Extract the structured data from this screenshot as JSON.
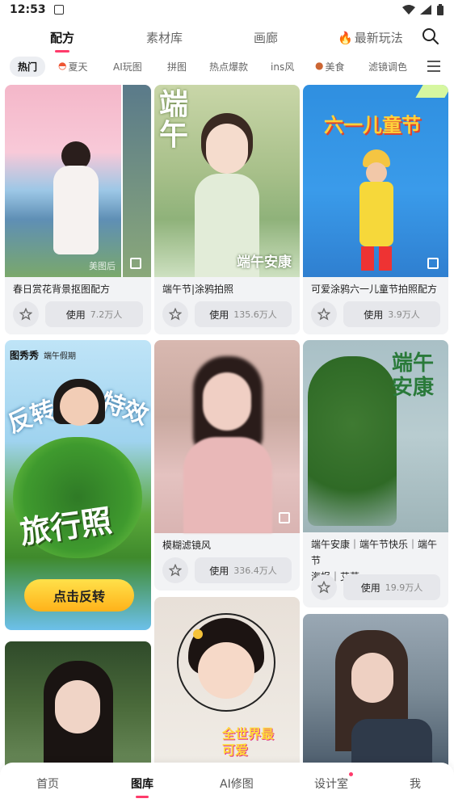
{
  "status_bar": {
    "time": "12:53"
  },
  "top_tabs": [
    "配方",
    "素材库",
    "画廊",
    "最新玩法"
  ],
  "chips": [
    "热门",
    "夏天",
    "AI玩图",
    "拼图",
    "热点爆款",
    "ins风",
    "美食",
    "滤镜调色"
  ],
  "cards": {
    "c1": {
      "title": "春日赏花背景抠图配方",
      "use_label": "使用",
      "count": "7.2万人",
      "watermark": "美图后"
    },
    "c2": {
      "title": "端午节|涂鸦拍照",
      "use_label": "使用",
      "count": "135.6万人",
      "overlay_big": "端午",
      "overlay_small": "端午安康"
    },
    "c3": {
      "title": "可爱涂鸦六一儿童节拍照配方",
      "use_label": "使用",
      "count": "3.9万人",
      "overlay_big": "六一儿童节"
    },
    "c4": {
      "brand": "图秀秀",
      "badge": "端午假期",
      "overlay_big": "旅行照",
      "cta": "点击反转",
      "side_left": "反转",
      "side_right": "特效"
    },
    "c5": {
      "title": "模糊滤镜风",
      "use_label": "使用",
      "count": "336.4万人"
    },
    "c6": {
      "title_line1": "端午安康｜端午节快乐｜端午节",
      "title_line2": "海报｜艾草",
      "use_label": "使用",
      "count": "19.9万人",
      "overlay_big": "端午安康"
    },
    "c8": {
      "overlay": "全世界最可爱"
    }
  },
  "bottom_nav": [
    "首页",
    "图库",
    "AI修图",
    "设计室",
    "我"
  ],
  "colors": {
    "accent": "#ff3b6b",
    "card_bg": "#f2f3f5",
    "button_bg": "#e6e7eb"
  }
}
